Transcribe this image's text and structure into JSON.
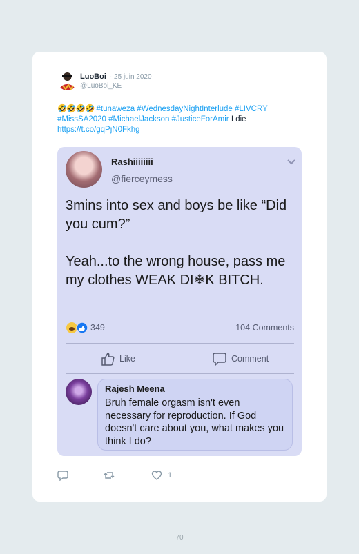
{
  "tweet": {
    "author_name": "LuoBoi",
    "date": "· 25 juin 2020",
    "handle": "@LuoBoi_KE",
    "emojis": "🤣🤣🤣🤣",
    "hashtags_line1": "#tunaweza #WednesdayNightInterlude #LIVCRY",
    "hashtags_line2": "#MissSA2020 #MichaelJackson #JusticeForAmir",
    "text_suffix": "I die",
    "link": "https://t.co/gqPjN0Fkhg",
    "like_count": "1",
    "icons": [
      "reply-icon",
      "retweet-icon",
      "heart-icon"
    ]
  },
  "embedded_post": {
    "poster_name": "Rashiiiiiiii",
    "poster_handle": "@fierceymess",
    "body_para1": "3mins into sex and boys be like “Did you cum?”",
    "body_para2": "Yeah...to the wrong house, pass me my clothes WEAK DI❄K BITCH.",
    "reaction_count": "349",
    "comments_count": "104 Comments",
    "like_label": "Like",
    "comment_label": "Comment",
    "comment": {
      "author": "Rajesh Meena",
      "text": "Bruh female orgasm isn't even necessary for reproduction. If God doesn't care about you, what makes you think I do?"
    }
  },
  "page_number": "70",
  "colors": {
    "background": "#e4ebee",
    "link": "#1da1f2",
    "embed_bg": "#d9dcf5"
  }
}
